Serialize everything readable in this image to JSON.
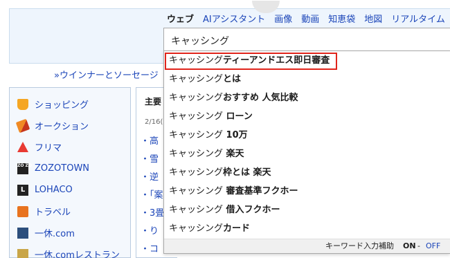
{
  "tabs": [
    {
      "label": "ウェブ",
      "active": true
    },
    {
      "label": "AIアシスタント"
    },
    {
      "label": "画像"
    },
    {
      "label": "動画"
    },
    {
      "label": "知恵袋"
    },
    {
      "label": "地図"
    },
    {
      "label": "リアルタイム"
    }
  ],
  "search": {
    "query": "キャッシング"
  },
  "promo": "»ウインナーとソーセージ",
  "sidebar": [
    {
      "label": "ショッピング",
      "icon": "cart-icon"
    },
    {
      "label": "オークション",
      "icon": "hammer-icon"
    },
    {
      "label": "フリマ",
      "icon": "flea-market-icon"
    },
    {
      "label": "ZOZOTOWN",
      "icon": "zozotown-icon",
      "mark": "ZO ZO"
    },
    {
      "label": "LOHACO",
      "icon": "lohaco-icon",
      "mark": "L"
    },
    {
      "label": "トラベル",
      "icon": "travel-bag-icon"
    },
    {
      "label": "一休.com",
      "icon": "ikyu-icon"
    },
    {
      "label": "一休.comレストラン",
      "icon": "ikyu-restaurant-icon"
    }
  ],
  "news": {
    "title": "主要",
    "date": "2/16(",
    "items": [
      "・高",
      "・雪",
      "・逆",
      "・「案",
      "・3畳",
      "・り",
      "・コ"
    ]
  },
  "suggestions": [
    {
      "prefix": "キャッシング",
      "suffix": "ティーアンドエス即日審査",
      "highlighted": true
    },
    {
      "prefix": "キャッシング",
      "suffix": "とは"
    },
    {
      "prefix": "キャッシング",
      "suffix": "おすすめ 人気比較"
    },
    {
      "prefix": "キャッシング",
      "suffix": " ローン"
    },
    {
      "prefix": "キャッシング",
      "suffix": " 10万"
    },
    {
      "prefix": "キャッシング",
      "suffix": " 楽天"
    },
    {
      "prefix": "キャッシング",
      "suffix": "枠とは 楽天"
    },
    {
      "prefix": "キャッシング",
      "suffix": " 審査基準フクホー"
    },
    {
      "prefix": "キャッシング",
      "suffix": " 借入フクホー"
    },
    {
      "prefix": "キャッシング",
      "suffix": "カード"
    }
  ],
  "footer": {
    "label": "キーワード入力補助",
    "on": "ON",
    "sep": "-",
    "off": "OFF"
  },
  "colors": {
    "highlight_border": "#e0241b",
    "link": "#1a44b8"
  }
}
